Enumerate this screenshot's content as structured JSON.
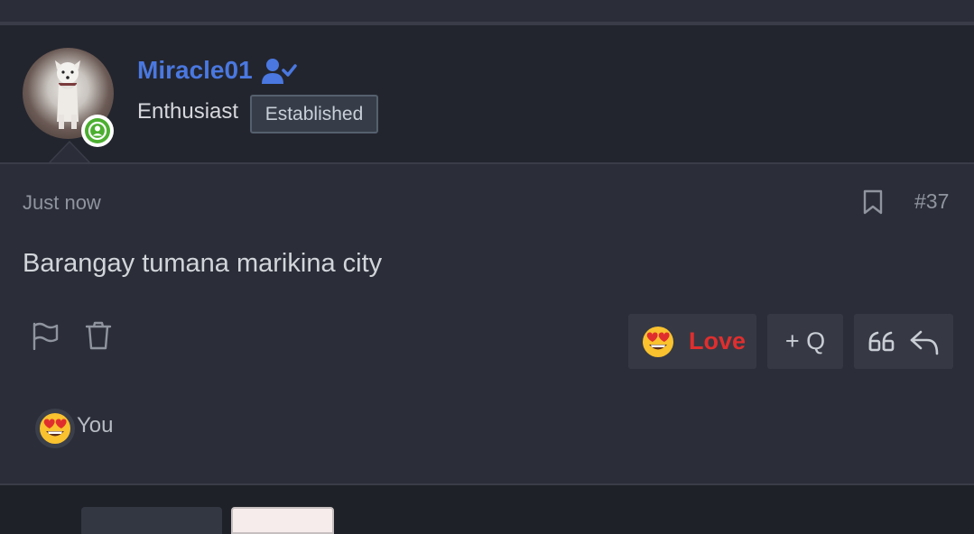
{
  "post": {
    "author": {
      "username": "Miracle01",
      "user_title": "Enthusiast",
      "banner": "Established",
      "online_status": "online"
    },
    "timestamp": "Just now",
    "post_number": "#37",
    "message": "Barangay tumana marikina city",
    "actions": {
      "love_label": "Love",
      "multiquote_label": "+ Q"
    },
    "reactions": {
      "icon": "heart-eyes-emoji",
      "summary": "You"
    }
  },
  "colors": {
    "username": "#4a78e0",
    "love": "#e02e2e",
    "online": "#4caf30",
    "background": "#2b2e38"
  },
  "icons": [
    "verified-user-icon",
    "bookmark-icon",
    "flag-icon",
    "trash-icon",
    "quote-icon",
    "reply-icon",
    "heart-eyes-emoji"
  ]
}
